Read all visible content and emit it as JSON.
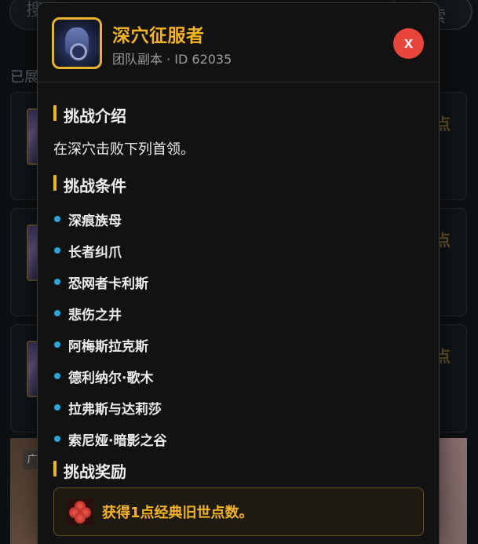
{
  "background": {
    "search_placeholder": "搜",
    "search_button": "索",
    "section_label": "已展",
    "cards": [
      {
        "points": "点"
      },
      {
        "points": "点"
      },
      {
        "points": "点"
      }
    ],
    "ad_tag": "广"
  },
  "modal": {
    "title": "深穴征服者",
    "subtitle": "团队副本 · ID 62035",
    "close_label": "x",
    "intro_heading": "挑战介绍",
    "intro_text": "在深穴击败下列首领。",
    "criteria_heading": "挑战条件",
    "criteria": [
      "深痕族母",
      "长者纠爪",
      "恐网者卡利斯",
      "悲伤之井",
      "阿梅斯拉克斯",
      "德利纳尔·歌木",
      "拉弗斯与达莉莎",
      "索尼娅·暗影之谷"
    ],
    "reward_heading": "挑战奖励",
    "reward_text": "获得1点经典旧世点数。"
  },
  "colors": {
    "accent_gold": "#f4b41f",
    "close_red": "#e9453a",
    "bullet_blue": "#2aa7d8"
  },
  "icons": {
    "achievement": "achievement-icon",
    "reward": "flower-icon",
    "close": "close-icon"
  }
}
